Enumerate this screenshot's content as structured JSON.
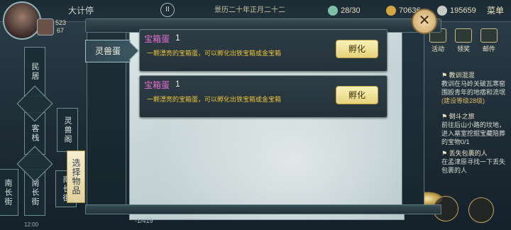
{
  "player": {
    "name": "大计停",
    "stat_a": "523",
    "stat_b": "67"
  },
  "topbar": {
    "date": "景历二十年正月二十二",
    "energy": "28/30",
    "copper": "70636",
    "silver": "195659",
    "menu_label": "菜单"
  },
  "top_icons": [
    {
      "label": "活动"
    },
    {
      "label": "领奖"
    },
    {
      "label": "邮件"
    }
  ],
  "locations": {
    "minju": "民居",
    "kezhan": "客栈",
    "lingshou_ge": "灵兽阁",
    "nanchangjie_1": "南长街",
    "nanchangjie_2": "南长街",
    "nanchangjie_3": "南长街"
  },
  "quests": [
    {
      "title": "教训混混",
      "desc": "教训在马岭关破瓦寒窑围殴青年的地痞和流氓",
      "note": "(建设等级28级)"
    },
    {
      "title": "倒斗之旅",
      "desc": "前往后山小路的坟地，进入墓室挖掘宝藏陪葬的宝物0/1"
    },
    {
      "title": "丢失包裹的人",
      "desc": "在孟津原寻找一下丢失包裹的人"
    }
  ],
  "dialog": {
    "category_tab": "灵兽蛋",
    "select_tag": "选择物品",
    "items": [
      {
        "name": "宝箱蛋",
        "qty": "1",
        "desc": "一颗漂亮的宝箱蛋，可以孵化出铁宝箱或金宝箱",
        "button": "孵化"
      },
      {
        "name": "宝箱蛋",
        "qty": "1",
        "desc": "一颗漂亮的宝箱蛋，可以孵化出铁宝箱或金宝箱",
        "button": "孵化"
      }
    ],
    "close_symbol": "✕"
  },
  "footer": {
    "pager": "-1/419",
    "clock": "12:00"
  },
  "colors": {
    "item_name": "#e36fd2",
    "item_desc": "#e9c33c",
    "button_bg": "#f5e9a6"
  }
}
